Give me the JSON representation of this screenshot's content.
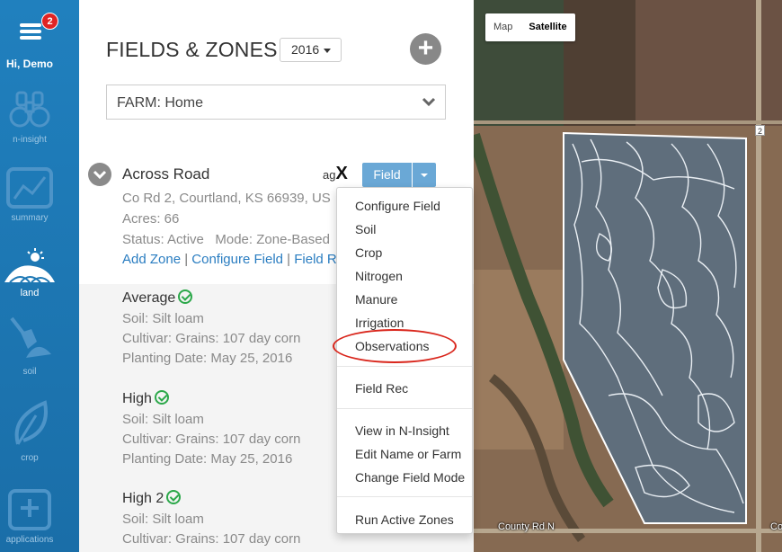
{
  "sidebar": {
    "notification_count": "2",
    "greeting": "Hi, Demo",
    "items": [
      {
        "label": "n-insight",
        "icon": "binoculars-icon"
      },
      {
        "label": "summary",
        "icon": "chart-icon"
      },
      {
        "label": "land",
        "icon": "land-icon"
      },
      {
        "label": "soil",
        "icon": "shovel-icon"
      },
      {
        "label": "crop",
        "icon": "leaf-icon"
      },
      {
        "label": "applications",
        "icon": "plus-box-icon"
      }
    ]
  },
  "header": {
    "title": "FIELDS & ZONES",
    "year": "2016",
    "farm_select": "FARM: Home"
  },
  "field": {
    "name": "Across Road",
    "provider_logo": "agX",
    "action_button": "Field",
    "address": "Co Rd 2, Courtland, KS 66939, US",
    "acres": "Acres: 66",
    "status": "Status: Active   Mode: Zone-Based",
    "links": [
      "Add Zone",
      "Configure Field",
      "Field R"
    ]
  },
  "zones": [
    {
      "name": "Average",
      "soil": "Soil: Silt loam",
      "cultivar": "Cultivar: Grains: 107 day corn",
      "planting": "Planting Date: May 25, 2016"
    },
    {
      "name": "High",
      "soil": "Soil: Silt loam",
      "cultivar": "Cultivar: Grains: 107 day corn",
      "planting": "Planting Date: May 25, 2016"
    },
    {
      "name": "High 2",
      "soil": "Soil: Silt loam",
      "cultivar": "Cultivar: Grains: 107 day corn"
    }
  ],
  "dropdown": {
    "group1": [
      "Configure Field",
      "Soil",
      "Crop",
      "Nitrogen",
      "Manure",
      "Irrigation",
      "Observations"
    ],
    "group2": [
      "Field Rec"
    ],
    "group3": [
      "View in N-Insight",
      "Edit Name or Farm",
      "Change Field Mode"
    ],
    "group4": [
      "Run Active Zones"
    ],
    "highlighted": "Observations"
  },
  "map": {
    "type_options": [
      "Map",
      "Satellite"
    ],
    "selected_type": "Satellite",
    "road_label": "County Rd N",
    "road_label_right": "Co",
    "route_shield": "2",
    "boundary_color": "#ffffff",
    "field_fill": "#5f6e7c"
  },
  "colors": {
    "sidebar": "#1d78b5",
    "accent": "#6aa8d6",
    "link": "#2a7dc1",
    "ok": "#2ca84a",
    "highlight_circle": "#d9261c"
  }
}
